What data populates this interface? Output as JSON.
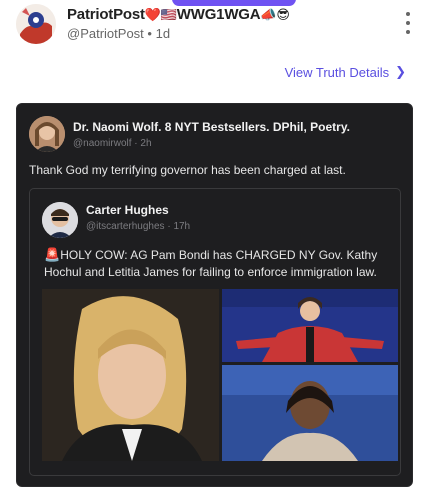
{
  "post": {
    "display_name": "PatriotPost",
    "name_suffix": "WWG1WGA",
    "name_emojis_before": "❤️🇺🇸",
    "name_emojis_after": "📣😎",
    "handle": "@PatriotPost",
    "age": "1d",
    "separator": "•",
    "more_icon": "more-vertical-icon"
  },
  "view_details": {
    "label": "View Truth Details",
    "chevron": "❯"
  },
  "quote": {
    "author": "Dr. Naomi Wolf. 8 NYT Bestsellers. DPhil, Poetry.",
    "handle": "@naomirwolf",
    "age": "2h",
    "separator": "·",
    "text": "Thank God my terrifying governor has been charged at last."
  },
  "nested": {
    "author": "Carter Hughes",
    "handle": "@itscarterhughes",
    "age": "17h",
    "separator": "·",
    "siren": "🚨",
    "text": "HOLY COW: AG Pam Bondi has CHARGED NY Gov. Kathy Hochul and Letitia James for failing to enforce immigration law."
  },
  "colors": {
    "accent": "#5a4fe0",
    "card_bg": "#1e1e20",
    "inner_border": "#3a3a3c"
  }
}
